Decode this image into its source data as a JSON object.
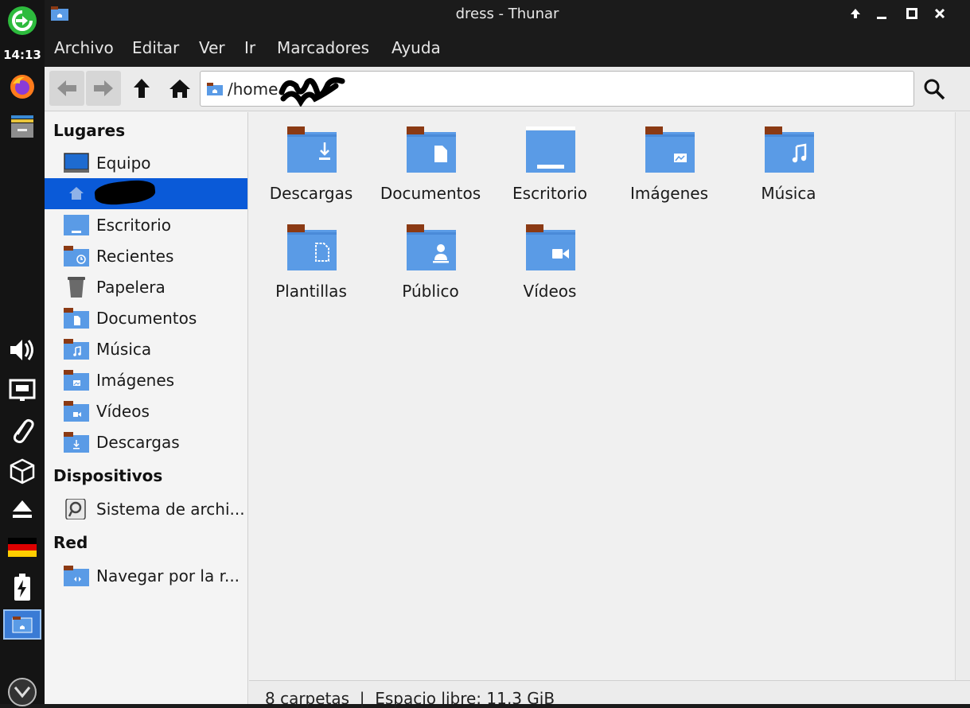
{
  "panel": {
    "clock": "14:13"
  },
  "window": {
    "title": "dress - Thunar"
  },
  "menubar": {
    "items": [
      "Archivo",
      "Editar",
      "Ver",
      "Ir",
      "Marcadores",
      "Ayuda"
    ]
  },
  "toolbar": {
    "location": "/home"
  },
  "sidebar": {
    "places_heading": "Lugares",
    "places": [
      {
        "label": "Equipo",
        "icon": "computer-icon"
      },
      {
        "label": "",
        "icon": "home-icon"
      },
      {
        "label": "Escritorio",
        "icon": "desktop-folder-icon"
      },
      {
        "label": "Recientes",
        "icon": "recent-folder-icon"
      },
      {
        "label": "Papelera",
        "icon": "trash-icon"
      },
      {
        "label": "Documentos",
        "icon": "documents-folder-icon"
      },
      {
        "label": "Música",
        "icon": "music-folder-icon"
      },
      {
        "label": "Imágenes",
        "icon": "pictures-folder-icon"
      },
      {
        "label": "Vídeos",
        "icon": "videos-folder-icon"
      },
      {
        "label": "Descargas",
        "icon": "downloads-folder-icon"
      }
    ],
    "devices_heading": "Dispositivos",
    "devices": [
      {
        "label": "Sistema de archi...",
        "icon": "drive-icon"
      }
    ],
    "network_heading": "Red",
    "network": [
      {
        "label": "Navegar por la r...",
        "icon": "network-folder-icon"
      }
    ]
  },
  "main": {
    "folders": [
      {
        "label": "Descargas",
        "icon": "downloads-folder-icon"
      },
      {
        "label": "Documentos",
        "icon": "documents-folder-icon"
      },
      {
        "label": "Escritorio",
        "icon": "desktop-folder-icon"
      },
      {
        "label": "Imágenes",
        "icon": "pictures-folder-icon"
      },
      {
        "label": "Música",
        "icon": "music-folder-icon"
      },
      {
        "label": "Plantillas",
        "icon": "templates-folder-icon"
      },
      {
        "label": "Público",
        "icon": "public-folder-icon"
      },
      {
        "label": "Vídeos",
        "icon": "videos-folder-icon"
      }
    ]
  },
  "statusbar": {
    "text": "8 carpetas  |  Espacio libre: 11,3 GiB"
  },
  "colors": {
    "selection": "#0a5ad8",
    "folder_blue": "#5a9be6",
    "folder_tab": "#8b3a14",
    "panel_bg": "#141414"
  }
}
